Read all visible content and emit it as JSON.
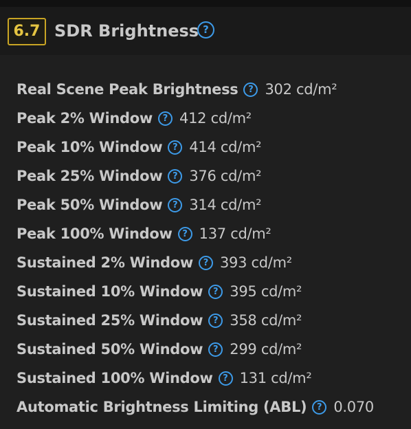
{
  "section": {
    "score": "6.7",
    "title": "SDR Brightness",
    "help_icon": "question-circle-icon",
    "accent_color": "#3d9be9",
    "score_color": "#c9a524"
  },
  "rows": [
    {
      "label": "Real Scene Peak Brightness",
      "value": "302 cd/m²"
    },
    {
      "label": "Peak 2% Window",
      "value": "412 cd/m²"
    },
    {
      "label": "Peak 10% Window",
      "value": "414 cd/m²"
    },
    {
      "label": "Peak 25% Window",
      "value": "376 cd/m²"
    },
    {
      "label": "Peak 50% Window",
      "value": "314 cd/m²"
    },
    {
      "label": "Peak 100% Window",
      "value": "137 cd/m²"
    },
    {
      "label": "Sustained 2% Window",
      "value": "393 cd/m²"
    },
    {
      "label": "Sustained 10% Window",
      "value": "395 cd/m²"
    },
    {
      "label": "Sustained 25% Window",
      "value": "358 cd/m²"
    },
    {
      "label": "Sustained 50% Window",
      "value": "299 cd/m²"
    },
    {
      "label": "Sustained 100% Window",
      "value": "131 cd/m²"
    },
    {
      "label": "Automatic Brightness Limiting (ABL)",
      "value": "0.070"
    }
  ]
}
